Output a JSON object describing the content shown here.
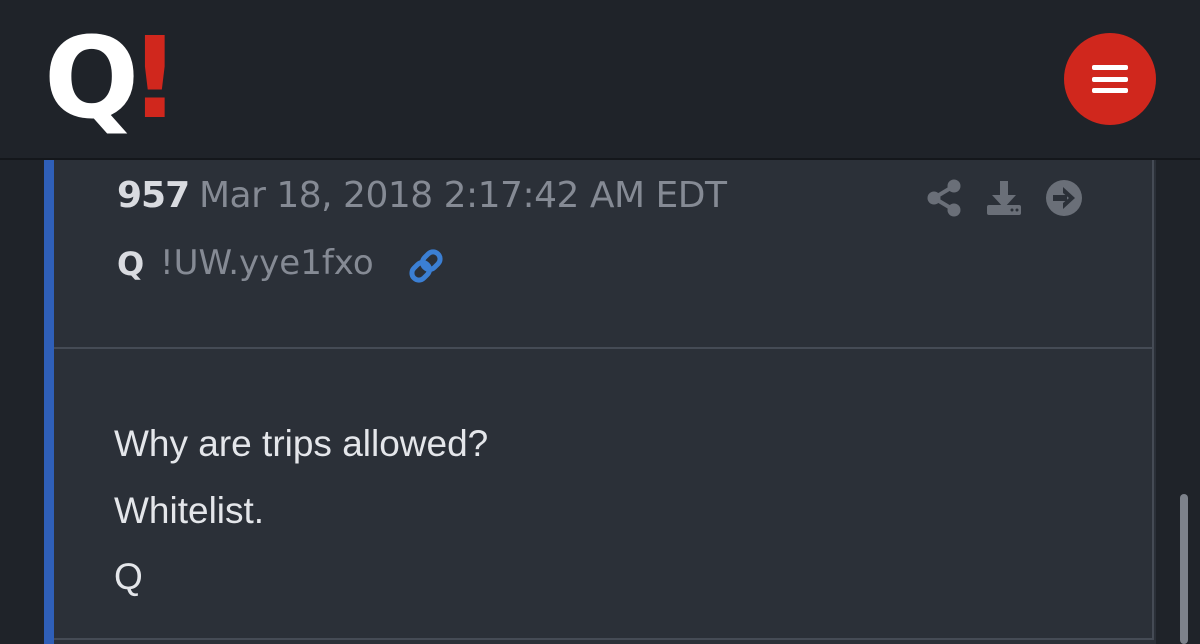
{
  "header": {
    "logo_letter": "Q",
    "logo_mark": "!",
    "menu_icon": "hamburger-menu-icon"
  },
  "post": {
    "number": "957",
    "date": "Mar 18, 2018 2:17:42 AM EDT",
    "author": "Q",
    "tripcode": "!UW.yye1fxo",
    "actions": [
      "share-icon",
      "download-icon",
      "arrow-right-circle-icon"
    ],
    "lines": [
      "Why are trips allowed?",
      "Whitelist.",
      "Q"
    ]
  },
  "colors": {
    "brand_red": "#d0271d",
    "accent_blue": "#2f5fb8",
    "link_blue": "#3b7fd4",
    "background": "#1f2329",
    "card": "#2b3038"
  }
}
